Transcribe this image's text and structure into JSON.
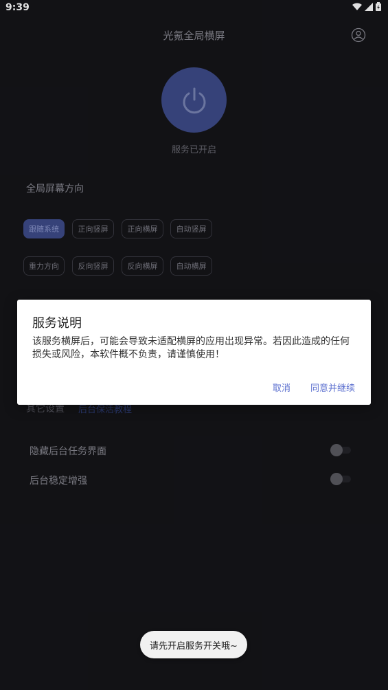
{
  "status_bar": {
    "time": "9:39",
    "icons": [
      "wifi-icon",
      "signal-icon",
      "battery-icon"
    ]
  },
  "header": {
    "title": "光氪全局横屏",
    "profile_icon": "user-icon"
  },
  "power": {
    "icon": "power-icon",
    "status": "服务已开启",
    "accent_color": "#3e4c8a"
  },
  "orientation": {
    "title": "全局屏幕方向",
    "row1": [
      "跟随系统",
      "正向竖屏",
      "正向横屏",
      "自动竖屏"
    ],
    "row2": [
      "重力方向",
      "反向竖屏",
      "反向横屏",
      "自动横屏"
    ],
    "selected": "跟随系统"
  },
  "other_settings": {
    "label": "其它设置",
    "link": "后台保活教程"
  },
  "settings": [
    {
      "label": "隐藏后台任务界面",
      "enabled": false
    },
    {
      "label": "后台稳定增强",
      "enabled": false
    }
  ],
  "dialog": {
    "title": "服务说明",
    "body": "该服务横屏后，可能会导致未适配横屏的应用出现异常。若因此造成的任何损失或风险，本软件概不负责，请谨慎使用！",
    "cancel": "取消",
    "confirm": "同意并继续",
    "button_color": "#5b6fcf"
  },
  "toast": {
    "text": "请先开启服务开关哦~"
  }
}
